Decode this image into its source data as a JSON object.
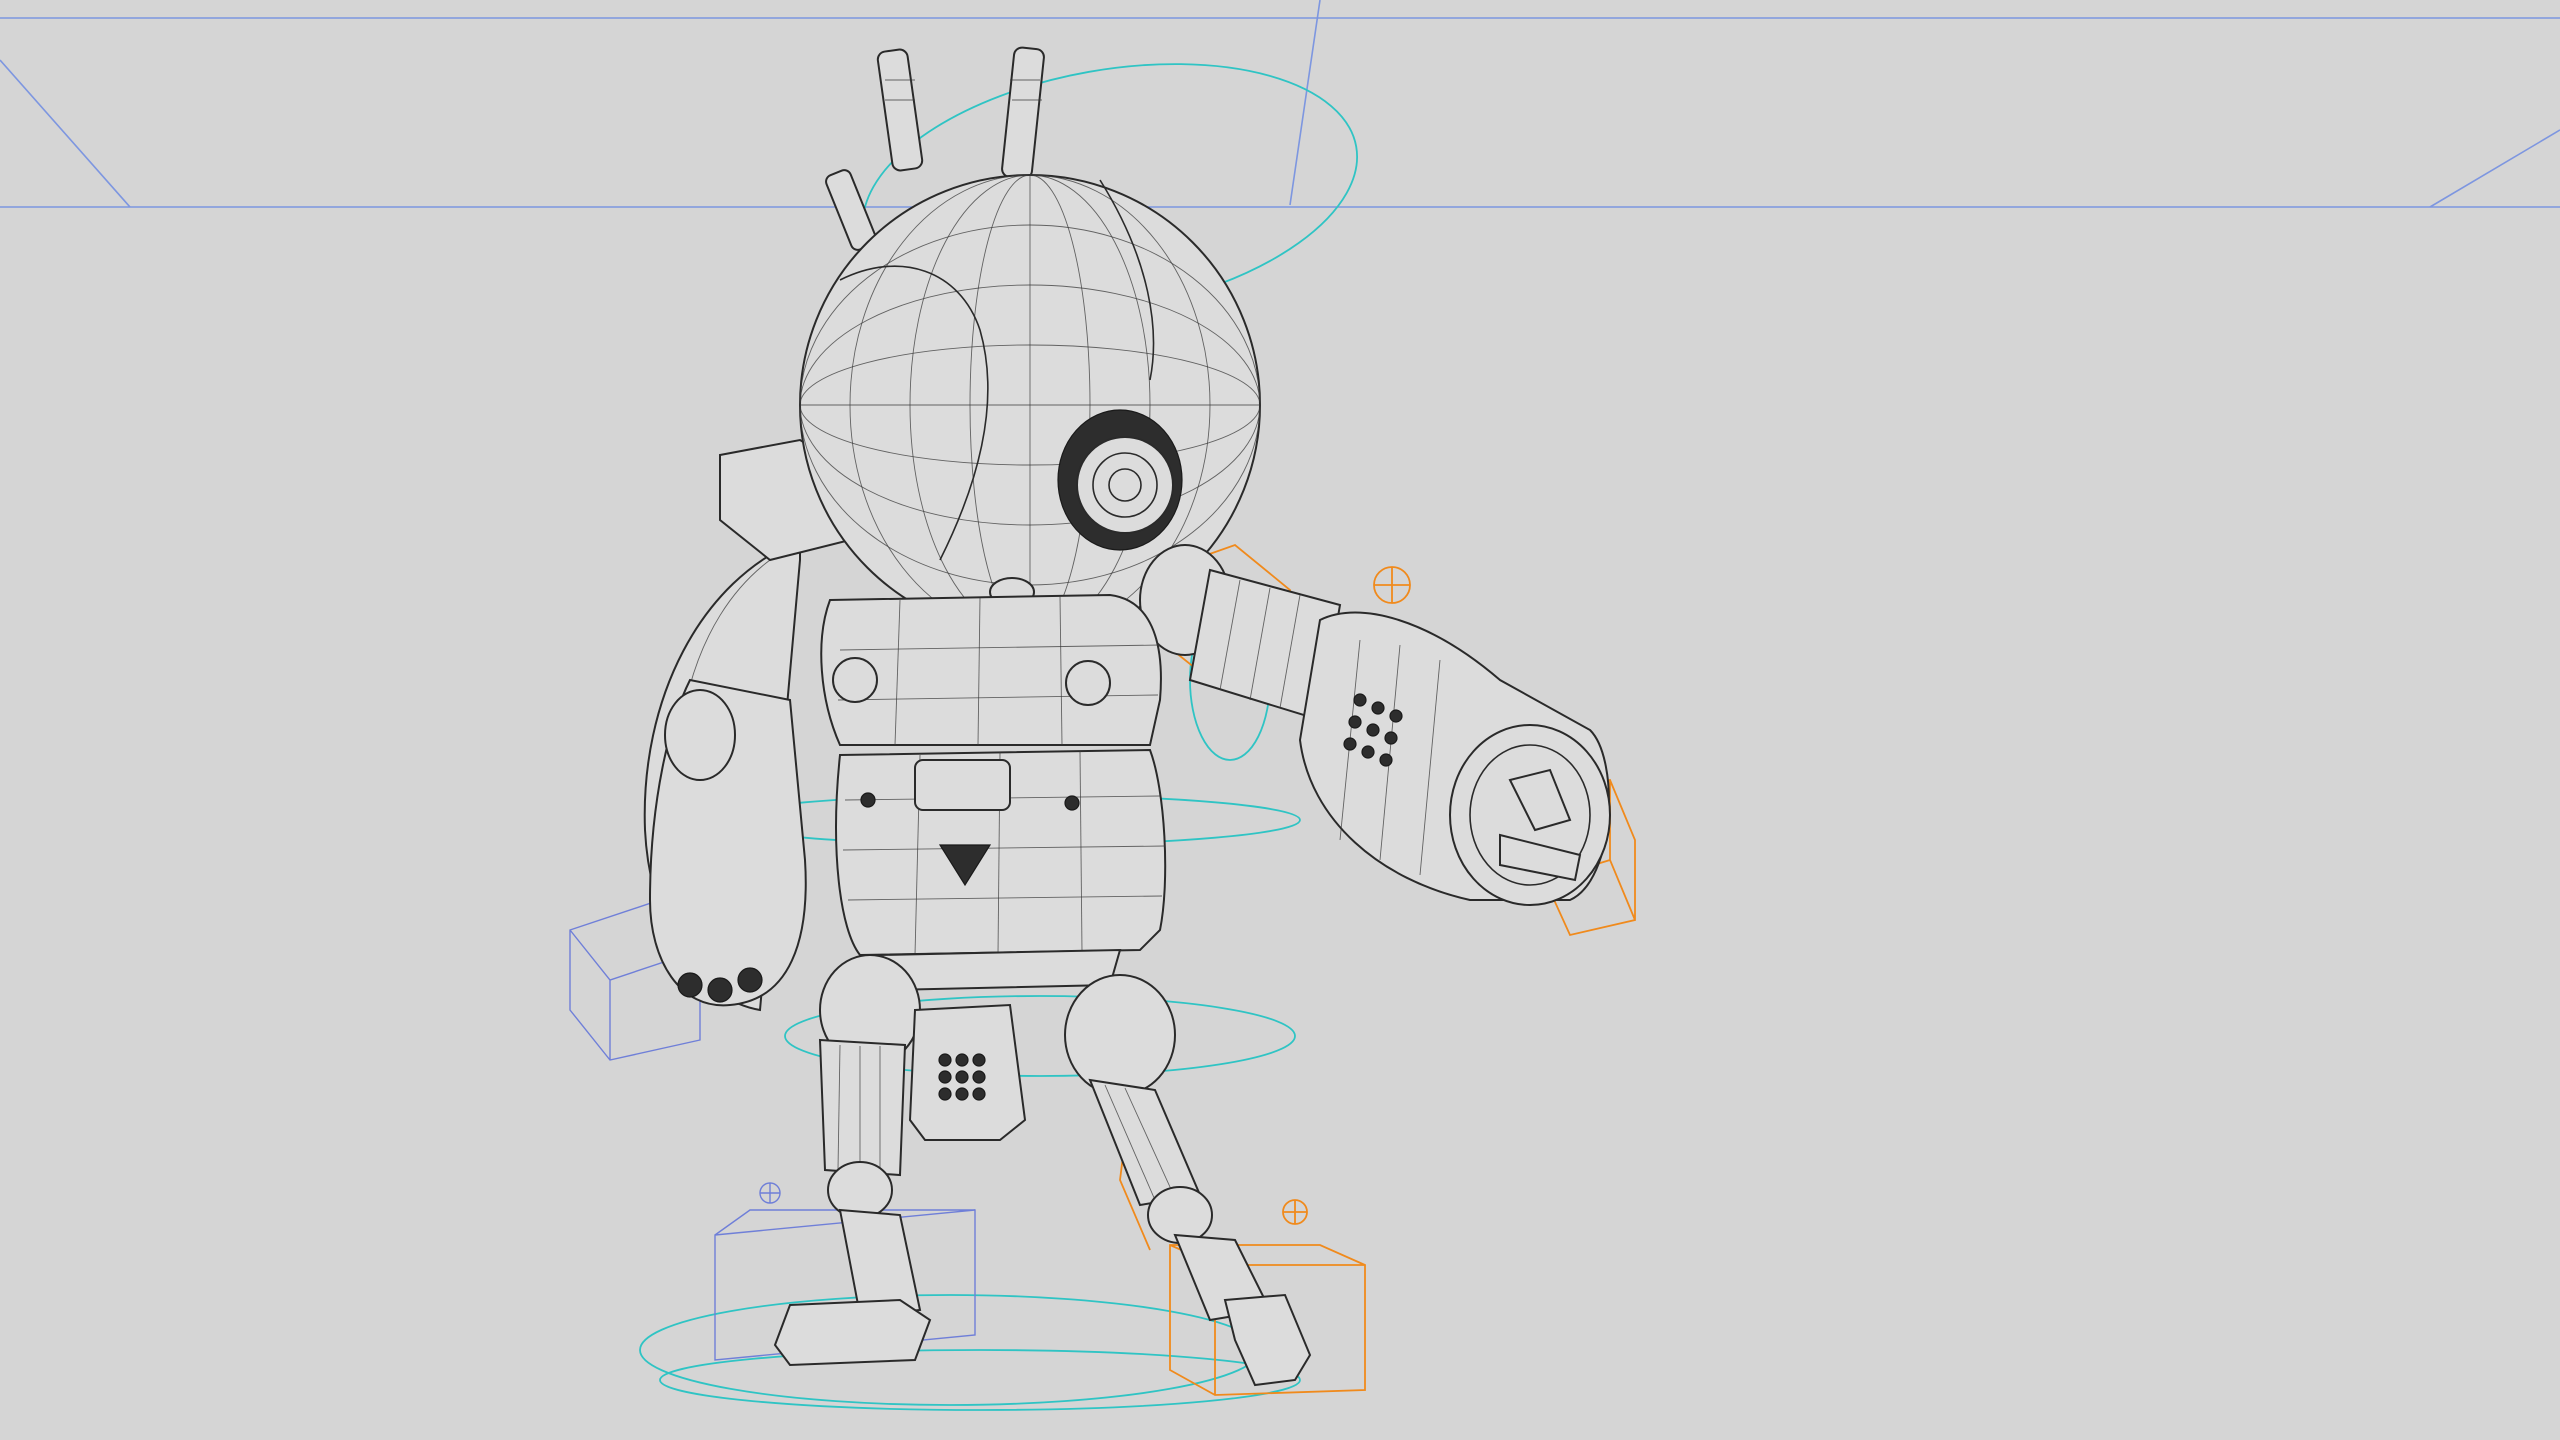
{
  "viewport": {
    "background": "#d5d5d5",
    "display_mode": "wireframe-on-shaded"
  },
  "model": {
    "subject": "robot-character"
  },
  "rig_colors": {
    "control_cyan": "#2fc4c4",
    "control_orange": "#f08a1c",
    "locator_blue": "#6f7fd8",
    "grid_blue": "#7d96e0"
  },
  "icons": [
    "gizmo-crosshair-icon"
  ]
}
